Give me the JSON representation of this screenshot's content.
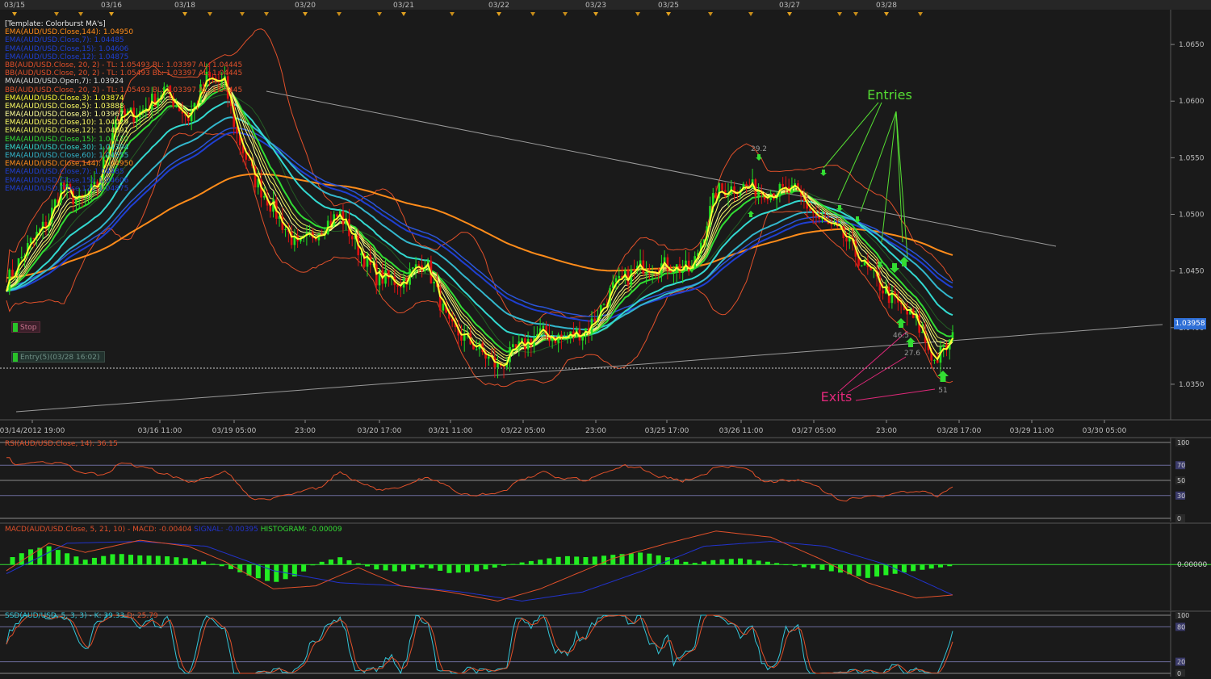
{
  "chart_data": [
    {
      "type": "candlestick",
      "template": "[Template: Colorburst MA's]",
      "top_dates": [
        "03/15",
        "03/16",
        "03/18",
        "03/20",
        "03/21",
        "03/22",
        "03/23",
        "03/25",
        "03/27",
        "03/28"
      ],
      "x_axis_labels": [
        "03/14/2012 19:00",
        "03/16 11:00",
        "03/19 05:00",
        "23:00",
        "03/20 17:00",
        "03/21 11:00",
        "03/22 05:00",
        "23:00",
        "03/25 17:00",
        "03/26 11:00",
        "03/27 05:00",
        "23:00",
        "03/28 17:00",
        "03/29 11:00",
        "03/30 05:00"
      ],
      "y_ticks": [
        "1.0650",
        "1.0600",
        "1.0550",
        "1.0500",
        "1.0450",
        "1.0400",
        "1.0350"
      ],
      "ylim": [
        1.032,
        1.068
      ],
      "last_price": "1.03958",
      "legend": [
        {
          "label": "EMA(AUD/USD.Close,144): ",
          "value": "1.04950",
          "color": "#ff8c1a"
        },
        {
          "label": "EMA(AUD/USD.Close,7): ",
          "value": "1.04485",
          "color": "#1f3fd1"
        },
        {
          "label": "EMA(AUD/USD.Close,15): ",
          "value": "1.04606",
          "color": "#1f3fd1"
        },
        {
          "label": "EMA(AUD/USD.Close,12): ",
          "value": "1.04875",
          "color": "#1f3fd1"
        },
        {
          "label": "BB(AUD/USD.Close, 20, 2) - TL: 1.05493  BL: 1.03397  AL: ",
          "value": "1.04445",
          "color": "#e0502a"
        },
        {
          "label": "BB(AUD/USD.Close, 20, 2) - TL: 1.05493  BL: 1.03397  AL: ",
          "value": "1.04445",
          "color": "#e0502a"
        },
        {
          "label": "MVA(AUD/USD.Open,7): ",
          "value": "1.03924",
          "color": "#d8d8d8"
        },
        {
          "label": "BB(AUD/USD.Close, 20, 2) - TL: 1.05493  BL: 1.03397  AL: ",
          "value": "1.04445",
          "color": "#e0502a"
        },
        {
          "label": "EMA(AUD/USD.Close,3): ",
          "value": "1.03874",
          "color": "#ffff33"
        },
        {
          "label": "EMA(AUD/USD.Close,5): ",
          "value": "1.03888",
          "color": "#ffff66"
        },
        {
          "label": "EMA(AUD/USD.Close,8): ",
          "value": "1.03967",
          "color": "#ffff99"
        },
        {
          "label": "EMA(AUD/USD.Close,10): ",
          "value": "1.04029",
          "color": "#ffff66"
        },
        {
          "label": "EMA(AUD/USD.Close,12): ",
          "value": "1.04091",
          "color": "#e8f060"
        },
        {
          "label": "EMA(AUD/USD.Close,15): ",
          "value": "1.04172",
          "color": "#33dd33"
        },
        {
          "label": "EMA(AUD/USD.Close,30): ",
          "value": "1.04394",
          "color": "#33d9d0"
        },
        {
          "label": "EMA(AUD/USD.Close,60): ",
          "value": "1.04555",
          "color": "#33b6cc"
        },
        {
          "label": "EMA(AUD/USD.Close,144): ",
          "value": "1.04950",
          "color": "#ff8c1a"
        },
        {
          "label": "EMA(AUD/USD.Close,7): ",
          "value": "1.04485",
          "color": "#1f3fd1"
        },
        {
          "label": "EMA(AUD/USD.Close,15): ",
          "value": "1.04606",
          "color": "#1f3fd1"
        },
        {
          "label": "EMA(AUD/USD.Close,12): ",
          "value": "1.04875",
          "color": "#1f3fd1"
        }
      ],
      "annotations": {
        "entries": "Entries",
        "exits": "Exits",
        "labels": [
          "29.2",
          "46.5",
          "27.6",
          "51"
        ],
        "stop": "Stop",
        "entry_order": "Entry(5)(03/28 16:02)"
      },
      "colors": {
        "up": "#22dd22",
        "down": "#dd1111",
        "ema144": "#ff8c1a",
        "ema60": "#33c6d9",
        "ema_fast": "#ffff33",
        "bb": "#e0502a",
        "blue": "#1f3fd1"
      },
      "close_series_desc": "piecewise hourly closes reconstructed from figure",
      "close_keypoints": [
        [
          0,
          1.044
        ],
        [
          8,
          1.0475
        ],
        [
          14,
          1.0495
        ],
        [
          18,
          1.0525
        ],
        [
          24,
          1.051
        ],
        [
          30,
          1.0525
        ],
        [
          36,
          1.0585
        ],
        [
          44,
          1.059
        ],
        [
          52,
          1.061
        ],
        [
          60,
          1.0585
        ],
        [
          66,
          1.062
        ],
        [
          72,
          1.0615
        ],
        [
          76,
          1.057
        ],
        [
          82,
          1.053
        ],
        [
          88,
          1.0505
        ],
        [
          96,
          1.047
        ],
        [
          102,
          1.0485
        ],
        [
          110,
          1.05
        ],
        [
          116,
          1.047
        ],
        [
          122,
          1.0445
        ],
        [
          130,
          1.044
        ],
        [
          138,
          1.046
        ],
        [
          146,
          1.04
        ],
        [
          154,
          1.0385
        ],
        [
          162,
          1.0365
        ],
        [
          168,
          1.038
        ],
        [
          176,
          1.0395
        ],
        [
          184,
          1.039
        ],
        [
          192,
          1.04
        ],
        [
          200,
          1.0435
        ],
        [
          210,
          1.0455
        ],
        [
          218,
          1.0455
        ],
        [
          226,
          1.045
        ],
        [
          234,
          1.052
        ],
        [
          242,
          1.0525
        ],
        [
          252,
          1.052
        ],
        [
          260,
          1.052
        ],
        [
          268,
          1.0495
        ],
        [
          276,
          1.048
        ],
        [
          284,
          1.045
        ],
        [
          292,
          1.0425
        ],
        [
          300,
          1.0405
        ],
        [
          306,
          1.037
        ],
        [
          312,
          1.039
        ]
      ]
    },
    {
      "type": "line",
      "title": "RSI(AUD/USD.Close, 14): 36.15",
      "y_ticks": [
        "100",
        "70",
        "50",
        "30",
        "0"
      ],
      "ylim": [
        0,
        100
      ],
      "series": [
        {
          "name": "RSI",
          "color": "#e0502a"
        }
      ]
    },
    {
      "type": "bar",
      "title_parts": [
        {
          "text": "MACD(AUD/USD.Close, 5, 21, 10) -  MACD: -0.00404  ",
          "color": "#e0502a"
        },
        {
          "text": "SIGNAL: -0.00395  ",
          "color": "#2233cc"
        },
        {
          "text": "HISTOGRAM: -0.00009",
          "color": "#33dd33"
        }
      ],
      "y_ticks": [
        "0.00000"
      ],
      "ylim": [
        -0.007,
        0.006
      ],
      "histogram_keypoints": [
        [
          0,
          0.0008
        ],
        [
          8,
          0.0025
        ],
        [
          14,
          0.003
        ],
        [
          18,
          0.0022
        ],
        [
          26,
          0.0008
        ],
        [
          36,
          0.0018
        ],
        [
          44,
          0.0015
        ],
        [
          52,
          0.0014
        ],
        [
          60,
          0.001
        ],
        [
          66,
          0.0004
        ],
        [
          72,
          -0.0004
        ],
        [
          80,
          -0.0018
        ],
        [
          88,
          -0.003
        ],
        [
          96,
          -0.0018
        ],
        [
          102,
          0.0002
        ],
        [
          110,
          0.0012
        ],
        [
          116,
          0.0002
        ],
        [
          122,
          -0.0008
        ],
        [
          130,
          -0.0012
        ],
        [
          138,
          -0.0004
        ],
        [
          146,
          -0.0014
        ],
        [
          154,
          -0.0012
        ],
        [
          162,
          -0.0004
        ],
        [
          168,
          0.0002
        ],
        [
          176,
          0.0008
        ],
        [
          184,
          0.0014
        ],
        [
          192,
          0.0012
        ],
        [
          200,
          0.0016
        ],
        [
          210,
          0.002
        ],
        [
          218,
          0.0012
        ],
        [
          226,
          0.0002
        ],
        [
          234,
          0.0008
        ],
        [
          242,
          0.001
        ],
        [
          252,
          0.0004
        ],
        [
          260,
          -0.0002
        ],
        [
          268,
          -0.0008
        ],
        [
          276,
          -0.0014
        ],
        [
          284,
          -0.0022
        ],
        [
          292,
          -0.0016
        ],
        [
          300,
          -0.001
        ],
        [
          306,
          -0.0006
        ],
        [
          312,
          -0.0002
        ]
      ],
      "macd_keypoints": [
        [
          0,
          -0.001
        ],
        [
          14,
          0.0035
        ],
        [
          26,
          0.002
        ],
        [
          44,
          0.004
        ],
        [
          60,
          0.003
        ],
        [
          72,
          0.0005
        ],
        [
          88,
          -0.004
        ],
        [
          102,
          -0.0035
        ],
        [
          116,
          -0.0005
        ],
        [
          130,
          -0.0035
        ],
        [
          146,
          -0.0045
        ],
        [
          162,
          -0.006
        ],
        [
          176,
          -0.004
        ],
        [
          200,
          0.001
        ],
        [
          218,
          0.0035
        ],
        [
          234,
          0.0055
        ],
        [
          252,
          0.0045
        ],
        [
          268,
          0.001
        ],
        [
          284,
          -0.003
        ],
        [
          300,
          -0.0055
        ],
        [
          312,
          -0.005
        ]
      ],
      "signal_keypoints": [
        [
          0,
          -0.0015
        ],
        [
          20,
          0.0035
        ],
        [
          44,
          0.0038
        ],
        [
          66,
          0.003
        ],
        [
          88,
          -0.001
        ],
        [
          110,
          -0.003
        ],
        [
          130,
          -0.0035
        ],
        [
          150,
          -0.0045
        ],
        [
          170,
          -0.006
        ],
        [
          190,
          -0.0045
        ],
        [
          210,
          -0.001
        ],
        [
          230,
          0.003
        ],
        [
          252,
          0.0038
        ],
        [
          270,
          0.003
        ],
        [
          290,
          0.0
        ],
        [
          312,
          -0.005
        ]
      ]
    },
    {
      "type": "line",
      "title_parts": [
        {
          "text": "SSD(AUD/USD, 5, 3, 3) -  ",
          "color": "#33c6d9"
        },
        {
          "text": "K: 39.33  ",
          "color": "#33c6d9"
        },
        {
          "text": "D: 25.79",
          "color": "#e0502a"
        }
      ],
      "y_ticks": [
        "100",
        "80",
        "20",
        "0"
      ],
      "ylim": [
        0,
        100
      ],
      "series": [
        {
          "name": "K",
          "color": "#33c6d9"
        },
        {
          "name": "D",
          "color": "#e0502a"
        }
      ]
    }
  ]
}
